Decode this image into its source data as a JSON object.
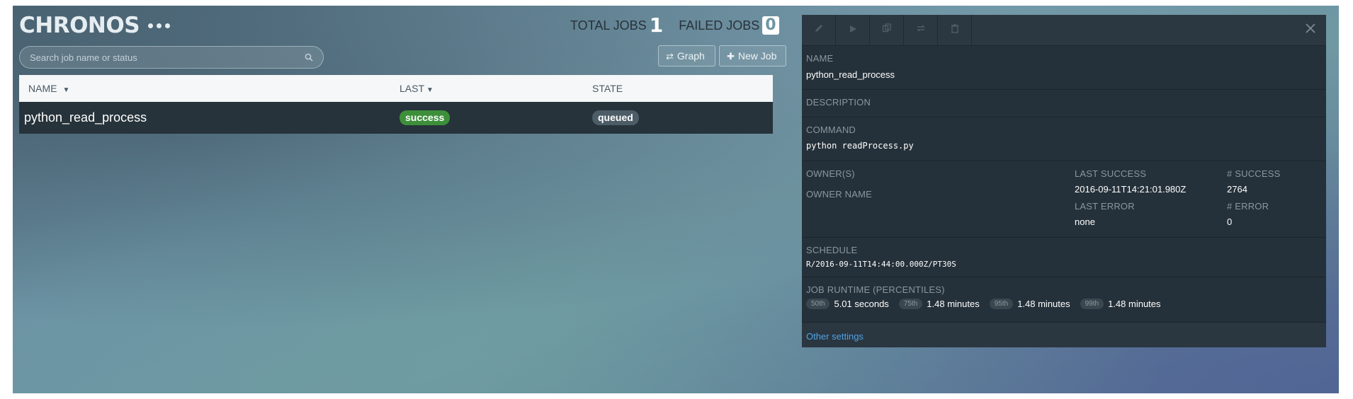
{
  "header": {
    "logo": "CHRONOS",
    "total_jobs_label": "TOTAL JOBS",
    "total_jobs": "1",
    "failed_jobs_label": "FAILED JOBS",
    "failed_jobs": "0"
  },
  "search": {
    "placeholder": "Search job name or status"
  },
  "toolbar": {
    "graph_label": "Graph",
    "new_job_label": "New Job"
  },
  "table": {
    "columns": [
      "NAME",
      "LAST",
      "STATE"
    ],
    "rows": [
      {
        "name": "python_read_process",
        "last": "success",
        "state": "queued"
      }
    ]
  },
  "detail": {
    "name_label": "NAME",
    "name": "python_read_process",
    "description_label": "DESCRIPTION",
    "command_label": "COMMAND",
    "command": "python readProcess.py",
    "owners_label": "OWNER(S)",
    "owner_name_label": "OWNER NAME",
    "last_success_label": "LAST SUCCESS",
    "last_success": "2016-09-11T14:21:01.980Z",
    "success_count_label": "# SUCCESS",
    "success_count": "2764",
    "last_error_label": "LAST ERROR",
    "last_error": "none",
    "error_count_label": "# ERROR",
    "error_count": "0",
    "schedule_label": "SCHEDULE",
    "schedule": "R/2016-09-11T14:44:00.000Z/PT30S",
    "runtime_label": "JOB RUNTIME (PERCENTILES)",
    "percentiles": [
      {
        "label": "50th",
        "value": "5.01 seconds"
      },
      {
        "label": "75th",
        "value": "1.48 minutes"
      },
      {
        "label": "95th",
        "value": "1.48 minutes"
      },
      {
        "label": "99th",
        "value": "1.48 minutes"
      }
    ],
    "other_settings": "Other settings"
  },
  "icons": {
    "edit": "pencil-icon",
    "run": "play-icon",
    "copy": "copy-icon",
    "retry": "repeat-icon",
    "delete": "trash-icon",
    "close": "close-icon",
    "search": "search-icon"
  },
  "colors": {
    "success": "#3d8f3a",
    "queued": "#4d5d67",
    "panel": "#25313a",
    "link": "#4fa3e6"
  }
}
